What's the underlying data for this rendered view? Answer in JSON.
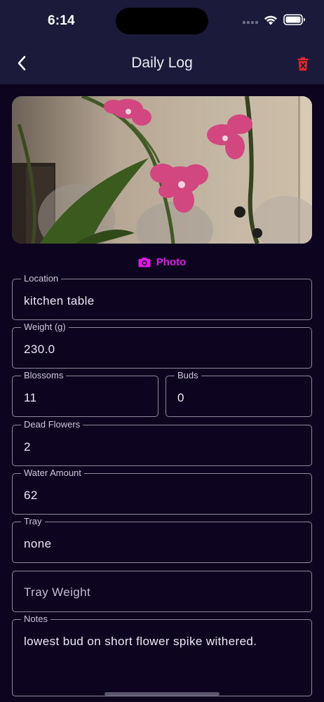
{
  "status_bar": {
    "time": "6:14"
  },
  "app_bar": {
    "title": "Daily Log"
  },
  "photo": {
    "button_label": "Photo"
  },
  "fields": {
    "location": {
      "label": "Location",
      "value": "kitchen table"
    },
    "weight": {
      "label": "Weight (g)",
      "value": "230.0"
    },
    "blossoms": {
      "label": "Blossoms",
      "value": "11"
    },
    "buds": {
      "label": "Buds",
      "value": "0"
    },
    "dead_flowers": {
      "label": "Dead Flowers",
      "value": "2"
    },
    "water_amount": {
      "label": "Water Amount",
      "value": "62"
    },
    "tray": {
      "label": "Tray",
      "value": "none"
    },
    "tray_weight": {
      "placeholder": "Tray Weight"
    },
    "notes": {
      "label": "Notes",
      "value": "lowest bud on short flower spike withered."
    }
  },
  "colors": {
    "background": "#0d0420",
    "app_bar": "#1b1a3a",
    "accent": "#e219e6",
    "delete": "#e0282b"
  }
}
